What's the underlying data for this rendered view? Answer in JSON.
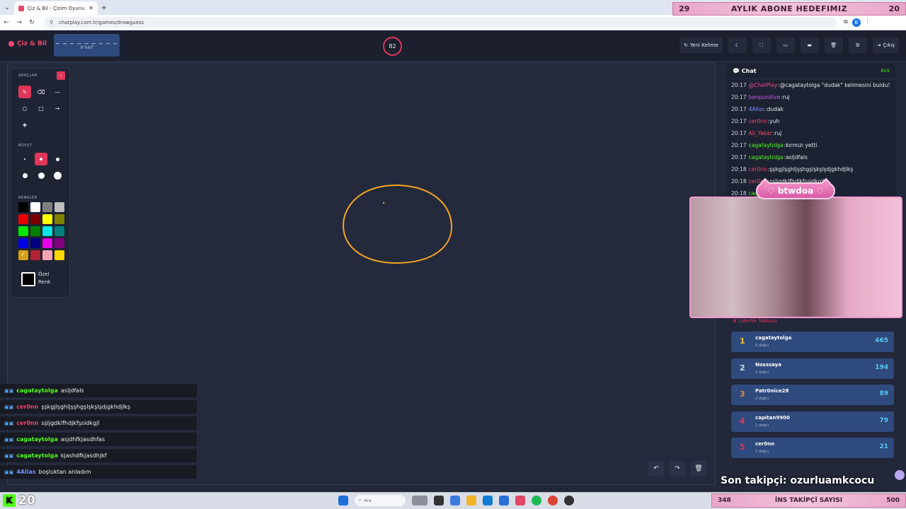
{
  "browser": {
    "tab_title": "Çiz & Bil - Çizim Oyunu",
    "url": "chatplay.com.tr/games/drawguess"
  },
  "overlay": {
    "sub_goal": {
      "current": "29",
      "label": "AYLIK ABONE HEDEFIMIZ",
      "target": "20"
    },
    "follow_goal": {
      "current": "348",
      "label": "İNS TAKİPÇİ SAYISI",
      "target": "500"
    },
    "last_follower": "Son takipçi: ozurluamkcocu",
    "kick_viewers": "20",
    "cam_name": "btwdoa"
  },
  "header": {
    "brand": "Çiz & Bil",
    "word_hint": "_ _ _ _ _ _ _ _ _",
    "letters": "9 harf",
    "timer": "82",
    "new_word": "Yeni Kelime",
    "exit": "Çıkış"
  },
  "tools": {
    "title": "ARAÇLAR",
    "size_title": "BOYUT",
    "colors_title": "RENKLER",
    "custom_color": "Özel Renk",
    "colors": [
      "#000000",
      "#ffffff",
      "#7f7f7f",
      "#bfbfbf",
      "#e80000",
      "#7a0000",
      "#ffff00",
      "#808000",
      "#00e600",
      "#008000",
      "#00e6e6",
      "#008080",
      "#0000e6",
      "#000080",
      "#e600e6",
      "#800080",
      "#d4a017",
      "#b22234",
      "#f4a3b5",
      "#ffd700"
    ]
  },
  "canvas_chat": [
    {
      "user": "cagataytolga",
      "color": "#53fc18",
      "text": "asljdfals"
    },
    {
      "user": "cer0nn",
      "color": "#f0476a",
      "text": "şşkgjlşghljşşhgşlşkşlşdjgkhdjlkş"
    },
    {
      "user": "cer0nn",
      "color": "#f0476a",
      "text": "sşljgdklfhdjkfşsidkgjl"
    },
    {
      "user": "cagataytolga",
      "color": "#53fc18",
      "text": "asjdhfkjasdhfas"
    },
    {
      "user": "cagataytolga",
      "color": "#53fc18",
      "text": "kjashdfkjasdhjkf"
    },
    {
      "user": "4Alias",
      "color": "#7b8cff",
      "text": "boşluktan anladım"
    }
  ],
  "chat": {
    "title": "Chat",
    "platform": "Kick",
    "messages": [
      {
        "time": "20:17",
        "user": "@ChatPlay",
        "color": "#e34a8c",
        "text": "@cagataytolga \"dudak\" kelimesini buldu!"
      },
      {
        "time": "20:17",
        "user": "benpunitive",
        "color": "#c45cf0",
        "text": "ruj"
      },
      {
        "time": "20:17",
        "user": "4Alias",
        "color": "#7b8cff",
        "text": "dudak"
      },
      {
        "time": "20:17",
        "user": "cer0nn",
        "color": "#f0476a",
        "text": "yuh"
      },
      {
        "time": "20:17",
        "user": "Ali_Yakar",
        "color": "#f0476a",
        "text": "ruj"
      },
      {
        "time": "20:17",
        "user": "cagataytolga",
        "color": "#53fc18",
        "text": "kırmızı yetti"
      },
      {
        "time": "20:17",
        "user": "cagataytolga",
        "color": "#53fc18",
        "text": "asljdfals"
      },
      {
        "time": "20:18",
        "user": "cer0nn",
        "color": "#f0476a",
        "text": "şşkgjlşghljşşhgşlşkşlşdjgkhdjlkş"
      },
      {
        "time": "20:18",
        "user": "cer0nn",
        "color": "#f0476a",
        "text": "sşljgdklfhdjkfşsidkgjl"
      },
      {
        "time": "20:18",
        "user": "cag",
        "color": "#53fc18",
        "text": ""
      }
    ]
  },
  "leaderboard": {
    "title": "Liderlik Tablosu",
    "rows": [
      {
        "rank": "1",
        "rank_color": "#f5c518",
        "name": "cagataytolga",
        "sub": "6 doğru",
        "score": "465"
      },
      {
        "rank": "2",
        "rank_color": "#d9dde7",
        "name": "Nosssaya",
        "sub": "3 doğru",
        "score": "194"
      },
      {
        "rank": "3",
        "rank_color": "#e0863a",
        "name": "Patr0nice28",
        "sub": "2 doğru",
        "score": "89"
      },
      {
        "rank": "4",
        "rank_color": "#e0365a",
        "name": "capitan9900",
        "sub": "1 doğru",
        "score": "79"
      },
      {
        "rank": "5",
        "rank_color": "#e0365a",
        "name": "cer0nn",
        "sub": "1 doğru",
        "score": "21"
      }
    ]
  },
  "taskbar": {
    "search": "Ara"
  }
}
